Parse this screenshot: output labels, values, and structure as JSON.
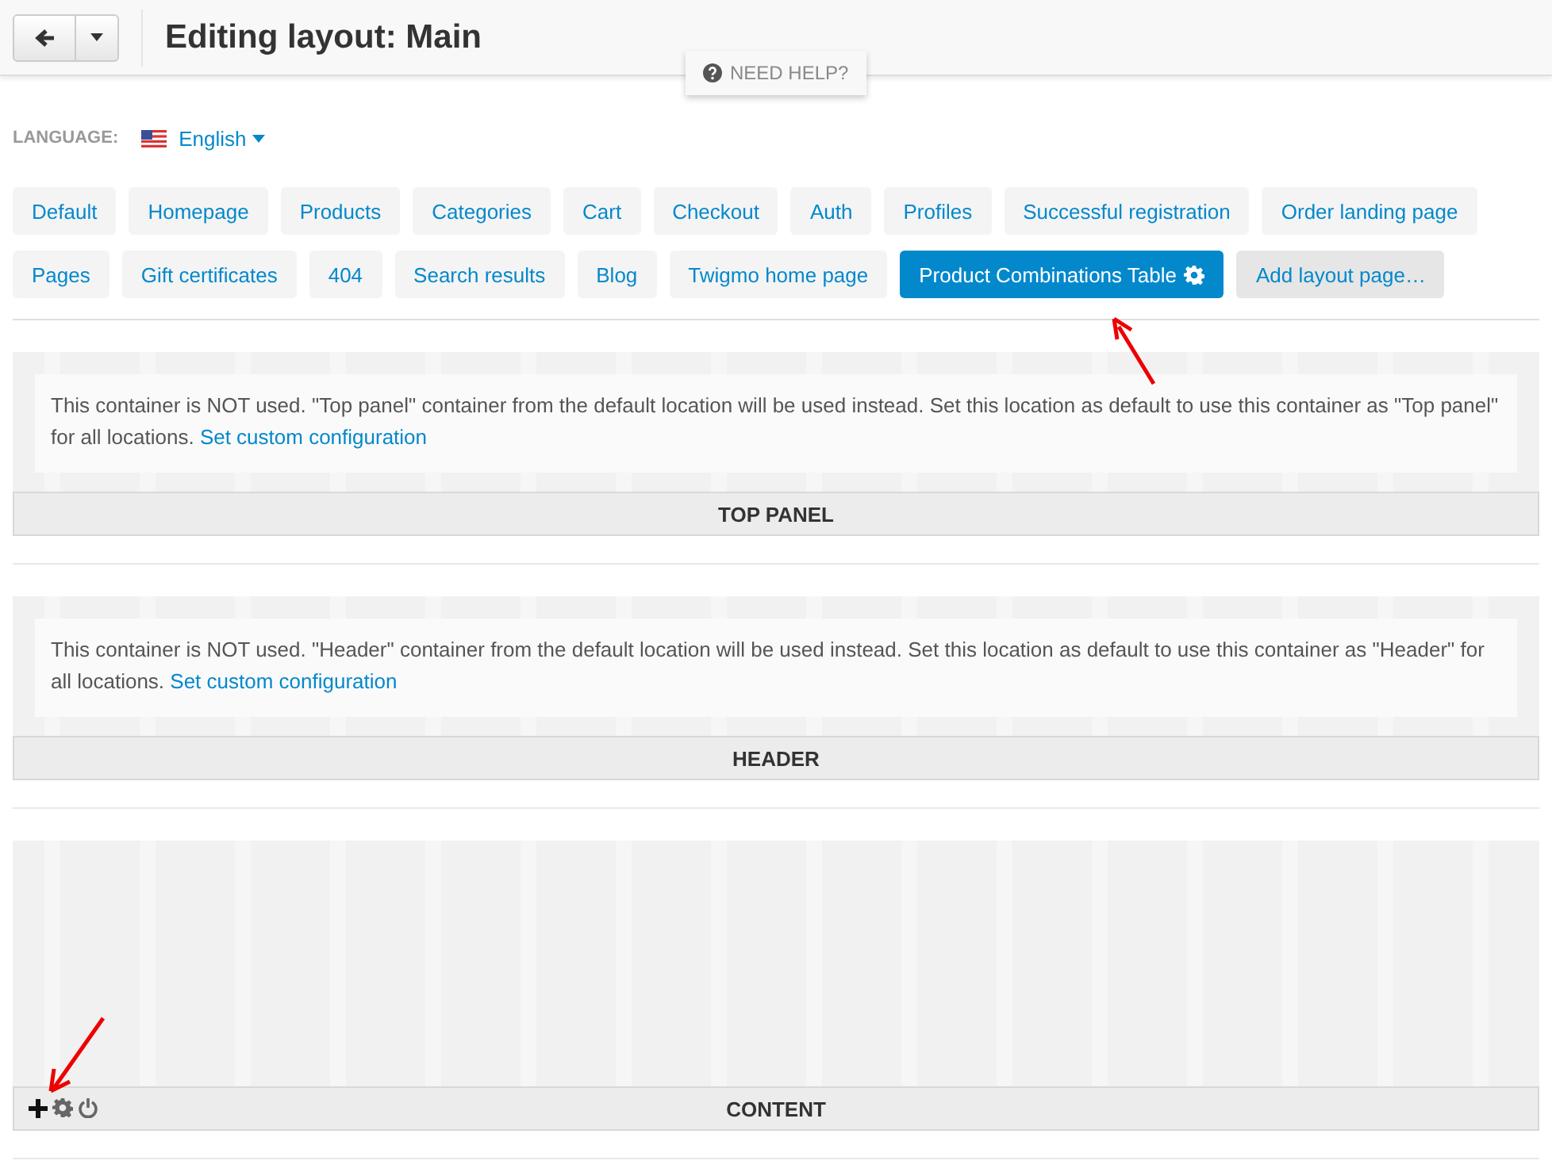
{
  "header": {
    "title": "Editing layout: Main",
    "help": "NEED HELP?"
  },
  "language": {
    "label": "LANGUAGE:",
    "value": "English"
  },
  "tabs": [
    {
      "label": "Default",
      "selected": false,
      "kind": "page"
    },
    {
      "label": "Homepage",
      "selected": false,
      "kind": "page"
    },
    {
      "label": "Products",
      "selected": false,
      "kind": "page"
    },
    {
      "label": "Categories",
      "selected": false,
      "kind": "page"
    },
    {
      "label": "Cart",
      "selected": false,
      "kind": "page"
    },
    {
      "label": "Checkout",
      "selected": false,
      "kind": "page"
    },
    {
      "label": "Auth",
      "selected": false,
      "kind": "page"
    },
    {
      "label": "Profiles",
      "selected": false,
      "kind": "page"
    },
    {
      "label": "Successful registration",
      "selected": false,
      "kind": "page"
    },
    {
      "label": "Order landing page",
      "selected": false,
      "kind": "page"
    },
    {
      "label": "Pages",
      "selected": false,
      "kind": "page"
    },
    {
      "label": "Gift certificates",
      "selected": false,
      "kind": "page"
    },
    {
      "label": "404",
      "selected": false,
      "kind": "page"
    },
    {
      "label": "Search results",
      "selected": false,
      "kind": "page"
    },
    {
      "label": "Blog",
      "selected": false,
      "kind": "page"
    },
    {
      "label": "Twigmo home page",
      "selected": false,
      "kind": "page"
    },
    {
      "label": "Product Combinations Table",
      "selected": true,
      "kind": "page"
    },
    {
      "label": "Add layout page…",
      "selected": false,
      "kind": "add"
    }
  ],
  "containers": [
    {
      "title": "TOP PANEL",
      "kind": "unused",
      "notice": "This container is NOT used. \"Top panel\" container from the default location will be used instead. Set this location as default to use this container as \"Top panel\" for all locations.",
      "link": "Set custom configuration"
    },
    {
      "title": "HEADER",
      "kind": "unused",
      "notice": "This container is NOT used. \"Header\" container from the default location will be used instead. Set this location as default to use this container as \"Header\" for all locations.",
      "link": "Set custom configuration"
    },
    {
      "title": "CONTENT",
      "kind": "active"
    }
  ]
}
